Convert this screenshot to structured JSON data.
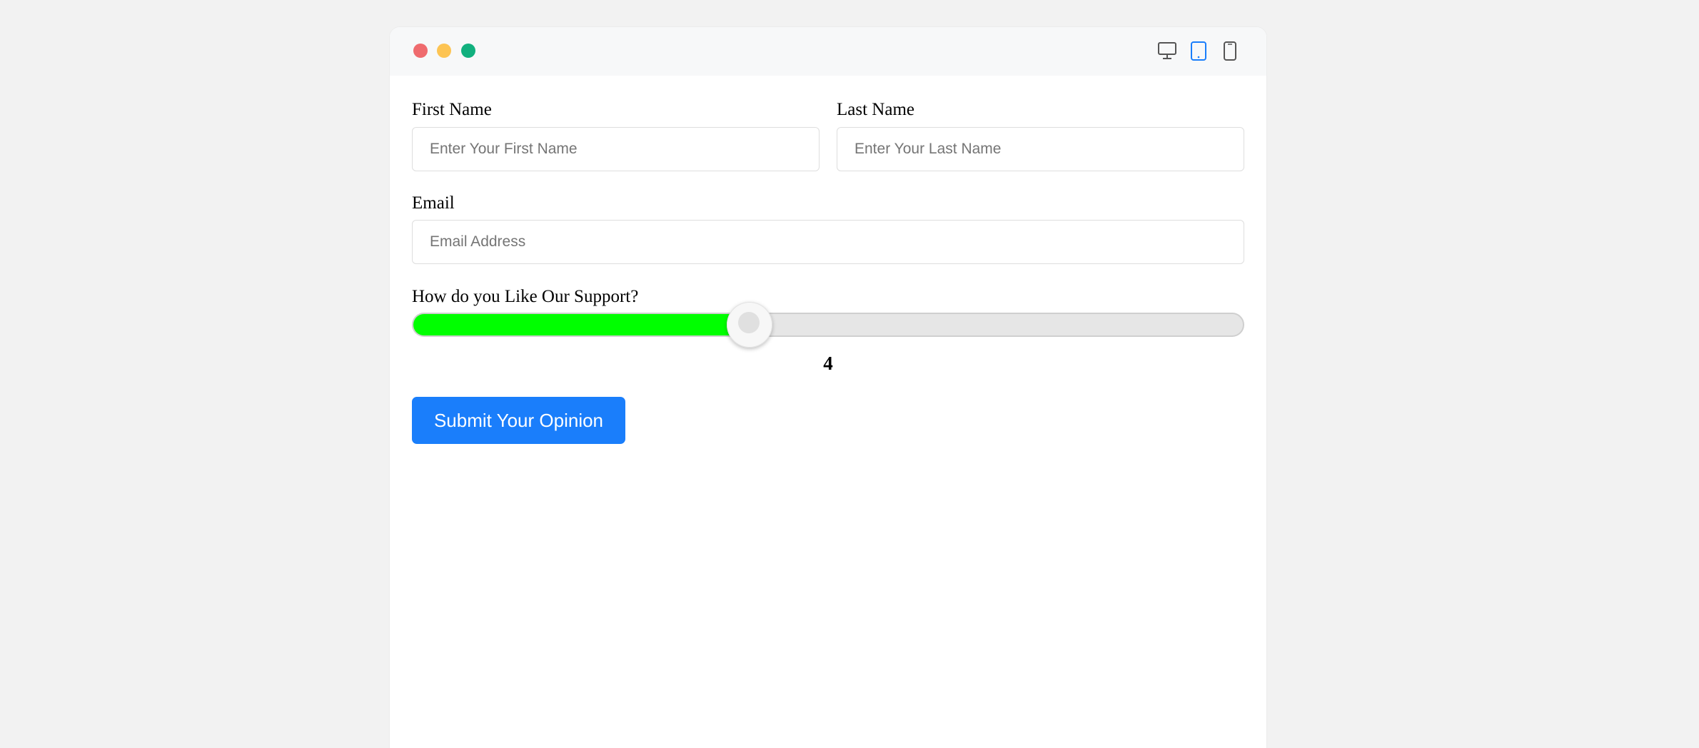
{
  "window": {
    "controls": {
      "close_color": "#ef6b6e",
      "minimize_color": "#fdc453",
      "maximize_color": "#11b07e"
    },
    "device_toggles": [
      {
        "icon": "desktop-icon",
        "selected": false
      },
      {
        "icon": "tablet-icon",
        "selected": true
      },
      {
        "icon": "mobile-icon",
        "selected": false
      }
    ],
    "accent_color": "#1a7efb"
  },
  "form": {
    "first_name": {
      "label": "First Name",
      "placeholder": "Enter Your First Name",
      "value": ""
    },
    "last_name": {
      "label": "Last Name",
      "placeholder": "Enter Your Last Name",
      "value": ""
    },
    "email": {
      "label": "Email",
      "placeholder": "Email Address",
      "value": ""
    },
    "support_rating": {
      "label": "How do you Like Our Support?",
      "value": "4",
      "fill_fraction": 0.406,
      "fill_color": "#00ff00"
    },
    "submit_label": "Submit Your Opinion"
  }
}
